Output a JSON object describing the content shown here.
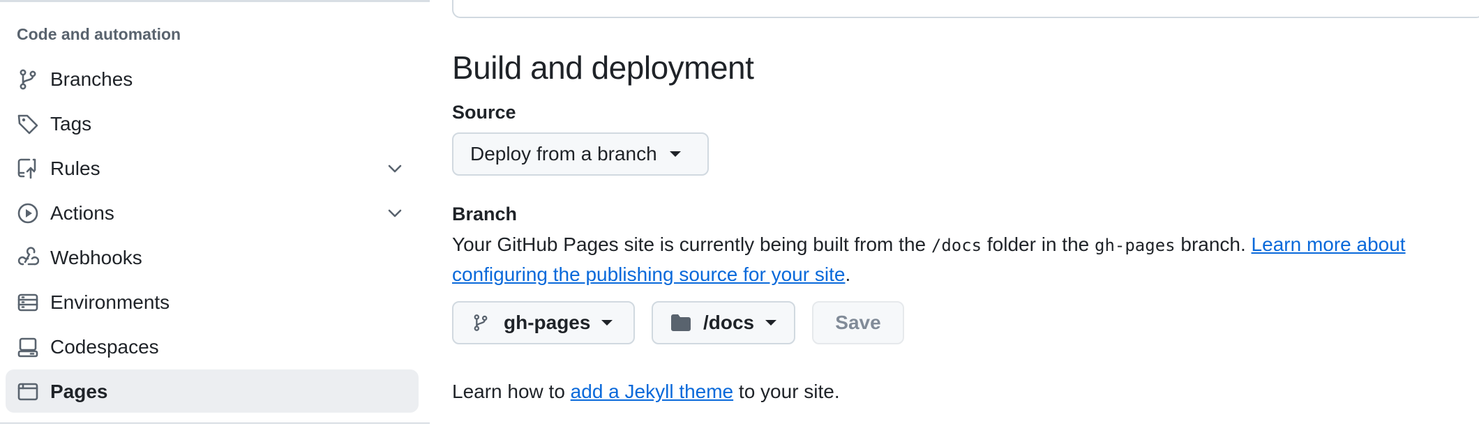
{
  "sidebar": {
    "section_heading": "Code and automation",
    "items": [
      {
        "label": "Branches",
        "icon": "git-branch-icon",
        "has_chevron": false,
        "selected": false
      },
      {
        "label": "Tags",
        "icon": "tag-icon",
        "has_chevron": false,
        "selected": false
      },
      {
        "label": "Rules",
        "icon": "repo-push-icon",
        "has_chevron": true,
        "selected": false
      },
      {
        "label": "Actions",
        "icon": "play-circle-icon",
        "has_chevron": true,
        "selected": false
      },
      {
        "label": "Webhooks",
        "icon": "webhook-icon",
        "has_chevron": false,
        "selected": false
      },
      {
        "label": "Environments",
        "icon": "server-icon",
        "has_chevron": false,
        "selected": false
      },
      {
        "label": "Codespaces",
        "icon": "codespaces-icon",
        "has_chevron": false,
        "selected": false
      },
      {
        "label": "Pages",
        "icon": "browser-icon",
        "has_chevron": false,
        "selected": true
      }
    ]
  },
  "main": {
    "title": "Build and deployment",
    "source": {
      "label": "Source",
      "selected": "Deploy from a branch"
    },
    "branch": {
      "label": "Branch",
      "desc_prefix": "Your GitHub Pages site is currently being built from the ",
      "folder_code": "/docs",
      "desc_middle": " folder in the ",
      "branch_code": "gh-pages",
      "desc_suffix": " branch. ",
      "learn_link": "Learn more about configuring the publishing source for your site",
      "desc_end": ".",
      "branch_select": "gh-pages",
      "folder_select": "/docs",
      "save_label": "Save"
    },
    "footer": {
      "prefix": "Learn how to ",
      "link": "add a Jekyll theme",
      "suffix": " to your site."
    }
  },
  "colors": {
    "link": "#0969da",
    "text": "#1f2328",
    "muted": "#59636e",
    "selected_bg": "#eceef1",
    "button_bg": "#f6f8fa",
    "border": "#d1d9e0"
  }
}
